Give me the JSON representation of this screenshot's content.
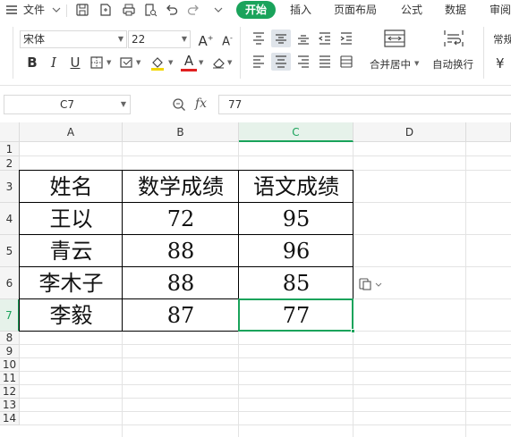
{
  "menubar": {
    "file_label": "文件",
    "tabs": [
      {
        "label": "开始",
        "active": true
      },
      {
        "label": "插入"
      },
      {
        "label": "页面布局"
      },
      {
        "label": "公式"
      },
      {
        "label": "数据"
      },
      {
        "label": "审阅"
      }
    ]
  },
  "toolbar": {
    "font_name": "宋体",
    "font_size": "22",
    "bold": "B",
    "italic": "I",
    "underline": "U",
    "font_color_glyph": "A",
    "merge_center_label": "合并居中",
    "wrap_text_label": "自动换行",
    "number_format_label": "常规",
    "currency_glyph": "¥"
  },
  "formula_bar": {
    "name_box": "C7",
    "fx_label": "fx",
    "value": "77"
  },
  "sheet": {
    "columns": [
      "A",
      "B",
      "C",
      "D"
    ],
    "active_column": "C",
    "rows": [
      "1",
      "2",
      "3",
      "4",
      "5",
      "6",
      "7",
      "8",
      "9",
      "10",
      "11",
      "12",
      "13",
      "14"
    ],
    "active_row": "7",
    "table": {
      "headers": [
        "姓名",
        "数学成绩",
        "语文成绩"
      ],
      "records": [
        [
          "王以",
          "72",
          "95"
        ],
        [
          "青云",
          "88",
          "96"
        ],
        [
          "李木子",
          "88",
          "85"
        ],
        [
          "李毅",
          "87",
          "77"
        ]
      ]
    },
    "accent_color": "#1aa35b"
  }
}
